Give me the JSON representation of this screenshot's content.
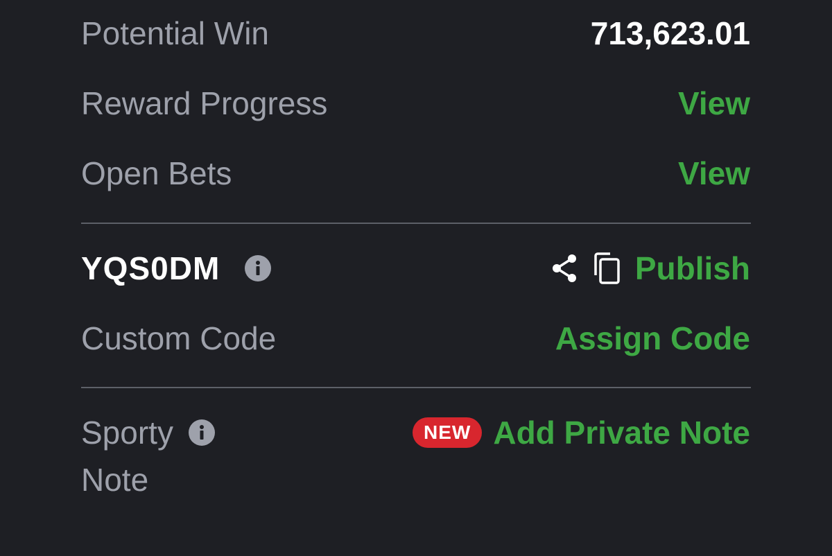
{
  "summary": {
    "potential_win_label": "Potential Win",
    "potential_win_value": "713,623.01",
    "reward_progress_label": "Reward Progress",
    "reward_progress_link": "View",
    "open_bets_label": "Open Bets",
    "open_bets_link": "View"
  },
  "booking": {
    "code": "YQS0DM",
    "publish_label": "Publish",
    "custom_code_label": "Custom Code",
    "assign_code_label": "Assign Code"
  },
  "note": {
    "label_line1": "Sporty",
    "label_line2": "Note",
    "badge": "NEW",
    "add_label": "Add Private Note"
  },
  "colors": {
    "background": "#1e1f24",
    "accent_green": "#3ea844",
    "badge_red": "#d8262e",
    "label_gray": "#9ea1ab"
  },
  "icons": [
    "info-icon",
    "share-icon",
    "copy-icon"
  ]
}
